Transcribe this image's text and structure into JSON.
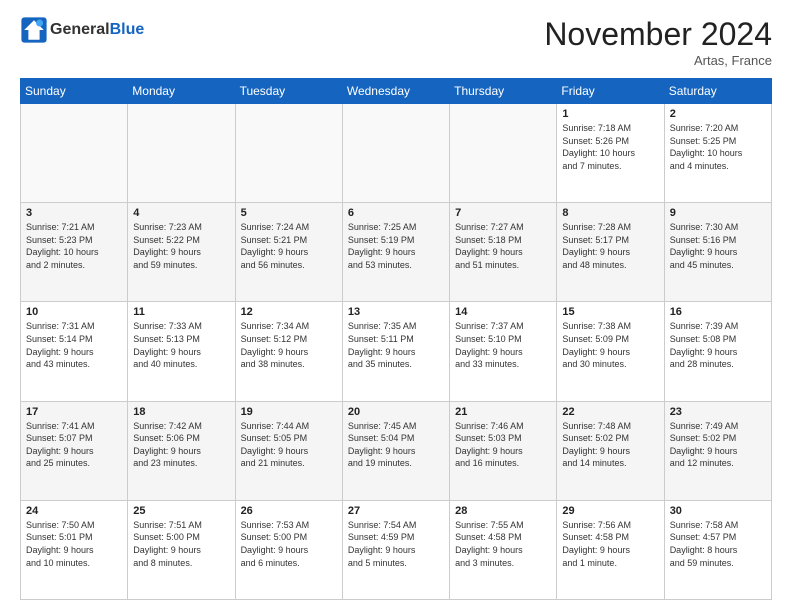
{
  "header": {
    "logo_general": "General",
    "logo_blue": "Blue",
    "month_title": "November 2024",
    "location": "Artas, France"
  },
  "days_of_week": [
    "Sunday",
    "Monday",
    "Tuesday",
    "Wednesday",
    "Thursday",
    "Friday",
    "Saturday"
  ],
  "weeks": [
    [
      {
        "day": "",
        "info": ""
      },
      {
        "day": "",
        "info": ""
      },
      {
        "day": "",
        "info": ""
      },
      {
        "day": "",
        "info": ""
      },
      {
        "day": "",
        "info": ""
      },
      {
        "day": "1",
        "info": "Sunrise: 7:18 AM\nSunset: 5:26 PM\nDaylight: 10 hours\nand 7 minutes."
      },
      {
        "day": "2",
        "info": "Sunrise: 7:20 AM\nSunset: 5:25 PM\nDaylight: 10 hours\nand 4 minutes."
      }
    ],
    [
      {
        "day": "3",
        "info": "Sunrise: 7:21 AM\nSunset: 5:23 PM\nDaylight: 10 hours\nand 2 minutes."
      },
      {
        "day": "4",
        "info": "Sunrise: 7:23 AM\nSunset: 5:22 PM\nDaylight: 9 hours\nand 59 minutes."
      },
      {
        "day": "5",
        "info": "Sunrise: 7:24 AM\nSunset: 5:21 PM\nDaylight: 9 hours\nand 56 minutes."
      },
      {
        "day": "6",
        "info": "Sunrise: 7:25 AM\nSunset: 5:19 PM\nDaylight: 9 hours\nand 53 minutes."
      },
      {
        "day": "7",
        "info": "Sunrise: 7:27 AM\nSunset: 5:18 PM\nDaylight: 9 hours\nand 51 minutes."
      },
      {
        "day": "8",
        "info": "Sunrise: 7:28 AM\nSunset: 5:17 PM\nDaylight: 9 hours\nand 48 minutes."
      },
      {
        "day": "9",
        "info": "Sunrise: 7:30 AM\nSunset: 5:16 PM\nDaylight: 9 hours\nand 45 minutes."
      }
    ],
    [
      {
        "day": "10",
        "info": "Sunrise: 7:31 AM\nSunset: 5:14 PM\nDaylight: 9 hours\nand 43 minutes."
      },
      {
        "day": "11",
        "info": "Sunrise: 7:33 AM\nSunset: 5:13 PM\nDaylight: 9 hours\nand 40 minutes."
      },
      {
        "day": "12",
        "info": "Sunrise: 7:34 AM\nSunset: 5:12 PM\nDaylight: 9 hours\nand 38 minutes."
      },
      {
        "day": "13",
        "info": "Sunrise: 7:35 AM\nSunset: 5:11 PM\nDaylight: 9 hours\nand 35 minutes."
      },
      {
        "day": "14",
        "info": "Sunrise: 7:37 AM\nSunset: 5:10 PM\nDaylight: 9 hours\nand 33 minutes."
      },
      {
        "day": "15",
        "info": "Sunrise: 7:38 AM\nSunset: 5:09 PM\nDaylight: 9 hours\nand 30 minutes."
      },
      {
        "day": "16",
        "info": "Sunrise: 7:39 AM\nSunset: 5:08 PM\nDaylight: 9 hours\nand 28 minutes."
      }
    ],
    [
      {
        "day": "17",
        "info": "Sunrise: 7:41 AM\nSunset: 5:07 PM\nDaylight: 9 hours\nand 25 minutes."
      },
      {
        "day": "18",
        "info": "Sunrise: 7:42 AM\nSunset: 5:06 PM\nDaylight: 9 hours\nand 23 minutes."
      },
      {
        "day": "19",
        "info": "Sunrise: 7:44 AM\nSunset: 5:05 PM\nDaylight: 9 hours\nand 21 minutes."
      },
      {
        "day": "20",
        "info": "Sunrise: 7:45 AM\nSunset: 5:04 PM\nDaylight: 9 hours\nand 19 minutes."
      },
      {
        "day": "21",
        "info": "Sunrise: 7:46 AM\nSunset: 5:03 PM\nDaylight: 9 hours\nand 16 minutes."
      },
      {
        "day": "22",
        "info": "Sunrise: 7:48 AM\nSunset: 5:02 PM\nDaylight: 9 hours\nand 14 minutes."
      },
      {
        "day": "23",
        "info": "Sunrise: 7:49 AM\nSunset: 5:02 PM\nDaylight: 9 hours\nand 12 minutes."
      }
    ],
    [
      {
        "day": "24",
        "info": "Sunrise: 7:50 AM\nSunset: 5:01 PM\nDaylight: 9 hours\nand 10 minutes."
      },
      {
        "day": "25",
        "info": "Sunrise: 7:51 AM\nSunset: 5:00 PM\nDaylight: 9 hours\nand 8 minutes."
      },
      {
        "day": "26",
        "info": "Sunrise: 7:53 AM\nSunset: 5:00 PM\nDaylight: 9 hours\nand 6 minutes."
      },
      {
        "day": "27",
        "info": "Sunrise: 7:54 AM\nSunset: 4:59 PM\nDaylight: 9 hours\nand 5 minutes."
      },
      {
        "day": "28",
        "info": "Sunrise: 7:55 AM\nSunset: 4:58 PM\nDaylight: 9 hours\nand 3 minutes."
      },
      {
        "day": "29",
        "info": "Sunrise: 7:56 AM\nSunset: 4:58 PM\nDaylight: 9 hours\nand 1 minute."
      },
      {
        "day": "30",
        "info": "Sunrise: 7:58 AM\nSunset: 4:57 PM\nDaylight: 8 hours\nand 59 minutes."
      }
    ]
  ]
}
